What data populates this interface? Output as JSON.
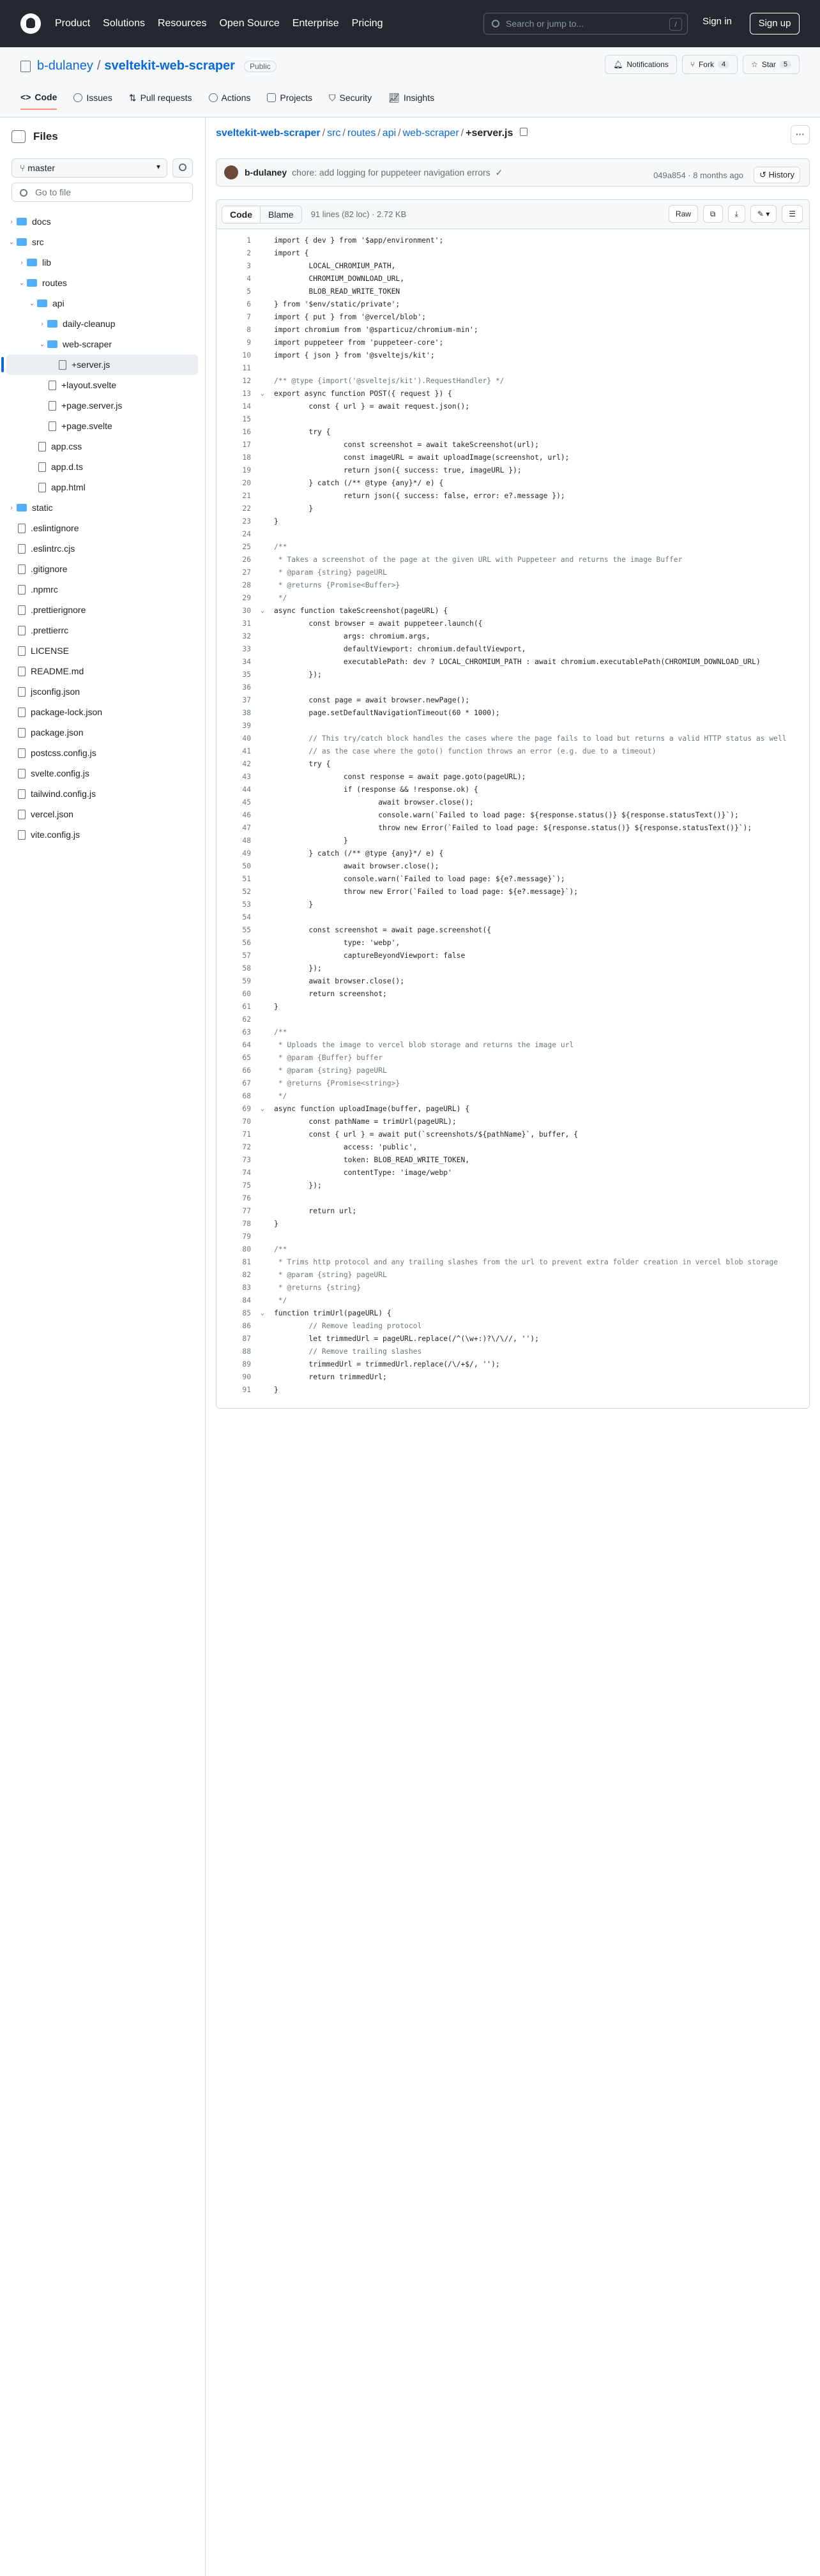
{
  "header": {
    "nav": [
      "Product",
      "Solutions",
      "Resources",
      "Open Source",
      "Enterprise",
      "Pricing"
    ],
    "search_placeholder": "Search or jump to...",
    "search_key": "/",
    "signin": "Sign in",
    "signup": "Sign up"
  },
  "repo": {
    "owner": "b-dulaney",
    "name": "sveltekit-web-scraper",
    "visibility": "Public",
    "notifications": "Notifications",
    "fork": "Fork",
    "fork_count": "4",
    "star": "Star",
    "star_count": "5",
    "tabs": [
      "Code",
      "Issues",
      "Pull requests",
      "Actions",
      "Projects",
      "Security",
      "Insights"
    ]
  },
  "sidebar": {
    "title": "Files",
    "branch": "master",
    "goto": "Go to file",
    "items": [
      {
        "label": "docs",
        "type": "folder",
        "depth": 0,
        "chev": "›"
      },
      {
        "label": "src",
        "type": "chev-only",
        "depth": 0,
        "chev": "⌄"
      },
      {
        "label": "lib",
        "type": "folder",
        "depth": 1,
        "chev": "›"
      },
      {
        "label": "routes",
        "type": "chev-only",
        "depth": 1,
        "chev": "⌄"
      },
      {
        "label": "api",
        "type": "folder",
        "depth": 2,
        "chev": "⌄"
      },
      {
        "label": "daily-cleanup",
        "type": "folder",
        "depth": 3,
        "chev": "›"
      },
      {
        "label": "web-scraper",
        "type": "folder",
        "depth": 3,
        "chev": "⌄"
      },
      {
        "label": "+server.js",
        "type": "file",
        "depth": 4,
        "chev": "",
        "active": true
      },
      {
        "label": "+layout.svelte",
        "type": "file",
        "depth": 3,
        "chev": ""
      },
      {
        "label": "+page.server.js",
        "type": "file",
        "depth": 3,
        "chev": ""
      },
      {
        "label": "+page.svelte",
        "type": "file",
        "depth": 3,
        "chev": ""
      },
      {
        "label": "app.css",
        "type": "file",
        "depth": 2,
        "chev": ""
      },
      {
        "label": "app.d.ts",
        "type": "file",
        "depth": 2,
        "chev": ""
      },
      {
        "label": "app.html",
        "type": "file",
        "depth": 2,
        "chev": ""
      },
      {
        "label": "static",
        "type": "folder",
        "depth": 0,
        "chev": "›"
      },
      {
        "label": ".eslintignore",
        "type": "file",
        "depth": 0,
        "chev": ""
      },
      {
        "label": ".eslintrc.cjs",
        "type": "file",
        "depth": 0,
        "chev": ""
      },
      {
        "label": ".gitignore",
        "type": "file",
        "depth": 0,
        "chev": ""
      },
      {
        "label": ".npmrc",
        "type": "file",
        "depth": 0,
        "chev": ""
      },
      {
        "label": ".prettierignore",
        "type": "file",
        "depth": 0,
        "chev": ""
      },
      {
        "label": ".prettierrc",
        "type": "file",
        "depth": 0,
        "chev": ""
      },
      {
        "label": "LICENSE",
        "type": "file",
        "depth": 0,
        "chev": ""
      },
      {
        "label": "README.md",
        "type": "file",
        "depth": 0,
        "chev": ""
      },
      {
        "label": "jsconfig.json",
        "type": "file",
        "depth": 0,
        "chev": ""
      },
      {
        "label": "package-lock.json",
        "type": "file",
        "depth": 0,
        "chev": ""
      },
      {
        "label": "package.json",
        "type": "file",
        "depth": 0,
        "chev": ""
      },
      {
        "label": "postcss.config.js",
        "type": "file",
        "depth": 0,
        "chev": ""
      },
      {
        "label": "svelte.config.js",
        "type": "file",
        "depth": 0,
        "chev": ""
      },
      {
        "label": "tailwind.config.js",
        "type": "file",
        "depth": 0,
        "chev": ""
      },
      {
        "label": "vercel.json",
        "type": "file",
        "depth": 0,
        "chev": ""
      },
      {
        "label": "vite.config.js",
        "type": "file",
        "depth": 0,
        "chev": ""
      }
    ]
  },
  "breadcrumb": {
    "parts": [
      "sveltekit-web-scraper",
      "src",
      "routes",
      "api",
      "web-scraper"
    ],
    "current": "+server.js"
  },
  "commit": {
    "author": "b-dulaney",
    "message": "chore: add logging for puppeteer navigation errors",
    "hash": "049a854",
    "age": "8 months ago",
    "history": "History"
  },
  "codebar": {
    "code": "Code",
    "blame": "Blame",
    "info": "91 lines (82 loc) · 2.72 KB",
    "raw": "Raw"
  },
  "code_lines": [
    "import { dev } from '$app/environment';",
    "import {",
    "        LOCAL_CHROMIUM_PATH,",
    "        CHROMIUM_DOWNLOAD_URL,",
    "        BLOB_READ_WRITE_TOKEN",
    "} from '$env/static/private';",
    "import { put } from '@vercel/blob';",
    "import chromium from '@sparticuz/chromium-min';",
    "import puppeteer from 'puppeteer-core';",
    "import { json } from '@sveltejs/kit';",
    "",
    "/** @type {import('@sveltejs/kit').RequestHandler} */",
    "export async function POST({ request }) {",
    "        const { url } = await request.json();",
    "",
    "        try {",
    "                const screenshot = await takeScreenshot(url);",
    "                const imageURL = await uploadImage(screenshot, url);",
    "                return json({ success: true, imageURL });",
    "        } catch (/** @type {any}*/ e) {",
    "                return json({ success: false, error: e?.message });",
    "        }",
    "}",
    "",
    "/**",
    " * Takes a screenshot of the page at the given URL with Puppeteer and returns the image Buffer",
    " * @param {string} pageURL",
    " * @returns {Promise<Buffer>}",
    " */",
    "async function takeScreenshot(pageURL) {",
    "        const browser = await puppeteer.launch({",
    "                args: chromium.args,",
    "                defaultViewport: chromium.defaultViewport,",
    "                executablePath: dev ? LOCAL_CHROMIUM_PATH : await chromium.executablePath(CHROMIUM_DOWNLOAD_URL)",
    "        });",
    "",
    "        const page = await browser.newPage();",
    "        page.setDefaultNavigationTimeout(60 * 1000);",
    "",
    "        // This try/catch block handles the cases where the page fails to load but returns a valid HTTP status as well",
    "        // as the case where the goto() function throws an error (e.g. due to a timeout)",
    "        try {",
    "                const response = await page.goto(pageURL);",
    "                if (response && !response.ok) {",
    "                        await browser.close();",
    "                        console.warn(`Failed to load page: ${response.status()} ${response.statusText()}`);",
    "                        throw new Error(`Failed to load page: ${response.status()} ${response.statusText()}`);",
    "                }",
    "        } catch (/** @type {any}*/ e) {",
    "                await browser.close();",
    "                console.warn(`Failed to load page: ${e?.message}`);",
    "                throw new Error(`Failed to load page: ${e?.message}`);",
    "        }",
    "",
    "        const screenshot = await page.screenshot({",
    "                type: 'webp',",
    "                captureBeyondViewport: false",
    "        });",
    "        await browser.close();",
    "        return screenshot;",
    "}",
    "",
    "/**",
    " * Uploads the image to vercel blob storage and returns the image url",
    " * @param {Buffer} buffer",
    " * @param {string} pageURL",
    " * @returns {Promise<string>}",
    " */",
    "async function uploadImage(buffer, pageURL) {",
    "        const pathName = trimUrl(pageURL);",
    "        const { url } = await put(`screenshots/${pathName}`, buffer, {",
    "                access: 'public',",
    "                token: BLOB_READ_WRITE_TOKEN,",
    "                contentType: 'image/webp'",
    "        });",
    "",
    "        return url;",
    "}",
    "",
    "/**",
    " * Trims http protocol and any trailing slashes from the url to prevent extra folder creation in vercel blob storage",
    " * @param {string} pageURL",
    " * @returns {string}",
    " */",
    "function trimUrl(pageURL) {",
    "        // Remove leading protocol",
    "        let trimmedUrl = pageURL.replace(/^(\\w+:)?\\/\\//, '');",
    "        // Remove trailing slashes",
    "        trimmedUrl = trimmedUrl.replace(/\\/+$/, '');",
    "        return trimmedUrl;",
    "}"
  ],
  "fold_lines": [
    13,
    30,
    69,
    85
  ],
  "colors": {
    "keyword": "#cf222e",
    "function": "#8250df",
    "string": "#0a3069",
    "constant": "#0550ae",
    "comment": "#6e7781",
    "link": "#0969da"
  }
}
